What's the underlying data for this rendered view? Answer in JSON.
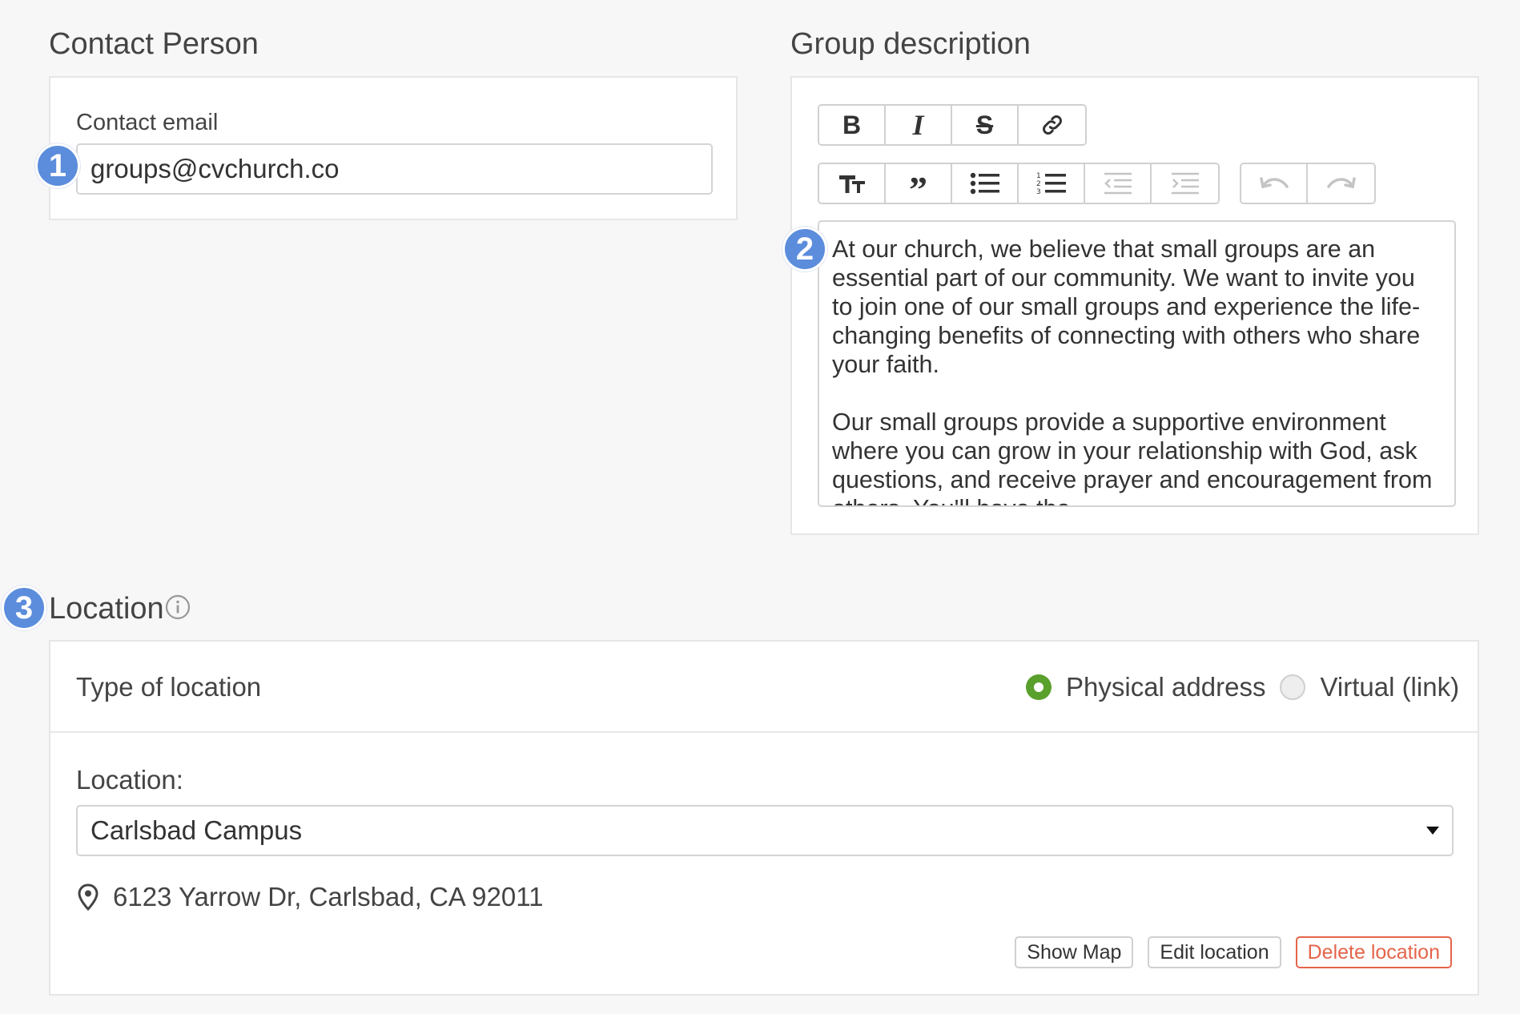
{
  "contact": {
    "section_title": "Contact Person",
    "email_label": "Contact email",
    "email_value": "groups@cvchurch.co",
    "badge": "1"
  },
  "description": {
    "section_title": "Group description",
    "badge": "2",
    "toolbar_row1": [
      {
        "icon": "bold-icon",
        "glyph": "B"
      },
      {
        "icon": "italic-icon",
        "glyph": "I"
      },
      {
        "icon": "strikethrough-icon",
        "glyph": "S"
      },
      {
        "icon": "link-icon",
        "glyph": ""
      }
    ],
    "toolbar_row2": [
      {
        "icon": "heading-icon"
      },
      {
        "icon": "quote-icon"
      },
      {
        "icon": "bullet-list-icon"
      },
      {
        "icon": "numbered-list-icon"
      },
      {
        "icon": "outdent-icon"
      },
      {
        "icon": "indent-icon"
      }
    ],
    "toolbar_history": [
      {
        "icon": "undo-icon"
      },
      {
        "icon": "redo-icon"
      }
    ],
    "paragraph1": "At our church, we believe that small groups are an essential part of our community. We want to invite you to join one of our small groups and experience the life-changing benefits of connecting with others who share your faith.",
    "paragraph2": "Our small groups provide a supportive environment where you can grow in your relationship with God, ask questions, and receive prayer and encouragement from others. You'll have the"
  },
  "location": {
    "section_title": "Location",
    "badge": "3",
    "type_label": "Type of location",
    "options": [
      {
        "label": "Physical address",
        "selected": true
      },
      {
        "label": "Virtual (link)",
        "selected": false
      }
    ],
    "select_label": "Location:",
    "select_value": "Carlsbad Campus",
    "address": "6123 Yarrow Dr, Carlsbad, CA 92011",
    "buttons": {
      "show_map": "Show Map",
      "edit": "Edit location",
      "delete": "Delete location"
    }
  },
  "colors": {
    "badge": "#5b8ddc",
    "radio_selected": "#5aa02c",
    "danger": "#e4644a"
  }
}
